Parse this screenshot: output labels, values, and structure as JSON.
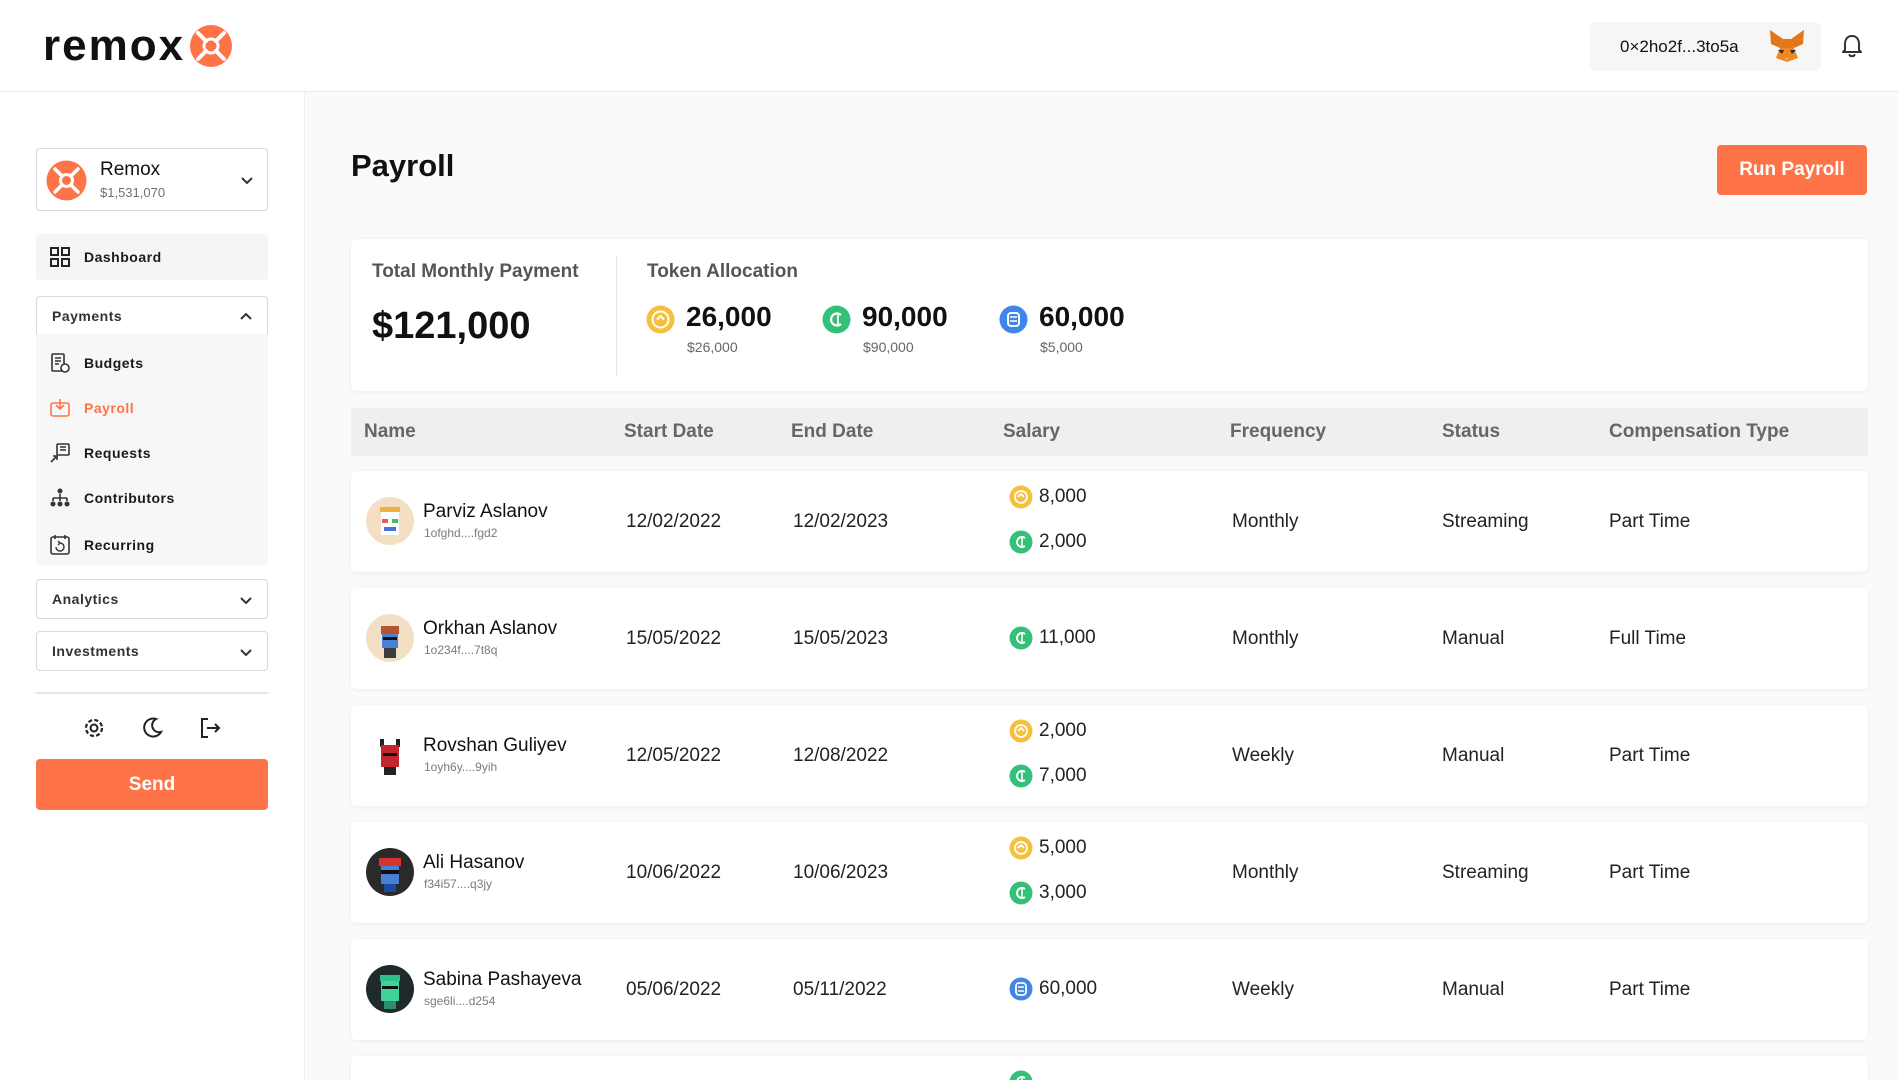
{
  "header": {
    "logo_text": "remox",
    "wallet_address": "0×2ho2f...3to5a"
  },
  "sidebar": {
    "org": {
      "name": "Remox",
      "balance": "$1,531,070"
    },
    "dashboard_label": "Dashboard",
    "payments_label": "Payments",
    "payments_items": [
      {
        "label": "Budgets",
        "icon": "budget-icon"
      },
      {
        "label": "Payroll",
        "icon": "payroll-icon",
        "active": true
      },
      {
        "label": "Requests",
        "icon": "requests-icon"
      },
      {
        "label": "Contributors",
        "icon": "contributors-icon"
      },
      {
        "label": "Recurring",
        "icon": "recurring-icon"
      }
    ],
    "analytics_label": "Analytics",
    "investments_label": "Investments",
    "send_label": "Send"
  },
  "page": {
    "title": "Payroll",
    "run_payroll_label": "Run Payroll"
  },
  "summary": {
    "total_label": "Total Monthly Payment",
    "total_value": "$121,000",
    "allocation_label": "Token Allocation",
    "tokens": [
      {
        "amount": "26,000",
        "usd": "$26,000",
        "color": "#f5c13d",
        "icon": "gold-coin-icon"
      },
      {
        "amount": "90,000",
        "usd": "$90,000",
        "color": "#35c07a",
        "icon": "green-coin-icon"
      },
      {
        "amount": "60,000",
        "usd": "$5,000",
        "color": "#3f86e8",
        "icon": "blue-coin-icon"
      }
    ]
  },
  "table": {
    "columns": [
      "Name",
      "Start Date",
      "End Date",
      "Salary",
      "Frequency",
      "Status",
      "Compensation Type"
    ],
    "rows": [
      {
        "name": "Parviz Aslanov",
        "address": "1ofghd....fgd2",
        "start": "12/02/2022",
        "end": "12/02/2023",
        "salary": [
          {
            "amount": "8,000",
            "token": "gold"
          },
          {
            "amount": "2,000",
            "token": "green"
          }
        ],
        "frequency": "Monthly",
        "status": "Streaming",
        "compensation": "Part Time"
      },
      {
        "name": "Orkhan Aslanov",
        "address": "1o234f....7t8q",
        "start": "15/05/2022",
        "end": "15/05/2023",
        "salary": [
          {
            "amount": "11,000",
            "token": "green"
          }
        ],
        "frequency": "Monthly",
        "status": "Manual",
        "compensation": "Full Time"
      },
      {
        "name": "Rovshan Guliyev",
        "address": "1oyh6y....9yih",
        "start": "12/05/2022",
        "end": "12/08/2022",
        "salary": [
          {
            "amount": "2,000",
            "token": "gold"
          },
          {
            "amount": "7,000",
            "token": "green"
          }
        ],
        "frequency": "Weekly",
        "status": "Manual",
        "compensation": "Part Time"
      },
      {
        "name": "Ali Hasanov",
        "address": "f34i57....q3jy",
        "start": "10/06/2022",
        "end": "10/06/2023",
        "salary": [
          {
            "amount": "5,000",
            "token": "gold"
          },
          {
            "amount": "3,000",
            "token": "green"
          }
        ],
        "frequency": "Monthly",
        "status": "Streaming",
        "compensation": "Part Time"
      },
      {
        "name": "Sabina Pashayeva",
        "address": "sge6li....d254",
        "start": "05/06/2022",
        "end": "05/11/2022",
        "salary": [
          {
            "amount": "60,000",
            "token": "blue"
          }
        ],
        "frequency": "Weekly",
        "status": "Manual",
        "compensation": "Part Time"
      }
    ]
  },
  "colors": {
    "accent": "#ff7348",
    "gold": "#f5c13d",
    "green": "#35c07a",
    "blue": "#3f86e8"
  }
}
